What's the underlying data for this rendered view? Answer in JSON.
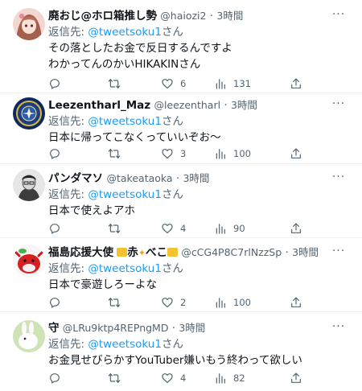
{
  "colors": {
    "text_primary": "#0f1419",
    "text_secondary": "#536471",
    "link": "#1d9bf0",
    "divider": "#eff3f4"
  },
  "tweets": [
    {
      "name": "廃おじ@ホロ箱推し勢",
      "handle": "@haiozi2",
      "dot": "·",
      "time": "3時間",
      "reply_prefix": "返信先: ",
      "reply_mention": "@tweetsoku1",
      "reply_suffix": "さん",
      "lines": [
        "その落としたお金で反日するんですよ",
        "わかってんのかいHIKAKINさん"
      ],
      "replies": "",
      "retweets": "",
      "likes": "6",
      "views": "131",
      "avatar_icon": "anime-character-avatar"
    },
    {
      "name": "Leezentharl_Maz",
      "handle": "@leezentharl",
      "dot": "·",
      "time": "3時間",
      "reply_prefix": "返信先: ",
      "reply_mention": "@tweetsoku1",
      "reply_suffix": "さん",
      "lines": [
        "日本に帰ってこなくっていいぞお～"
      ],
      "replies": "",
      "retweets": "",
      "likes": "3",
      "views": "100",
      "avatar_icon": "seal-emblem-avatar"
    },
    {
      "name": "パンダマソ",
      "handle": "@takeataoka",
      "dot": "·",
      "time": "3時間",
      "reply_prefix": "返信先: ",
      "reply_mention": "@tweetsoku1",
      "reply_suffix": "さん",
      "lines": [
        "日本で使えよアホ"
      ],
      "replies": "",
      "retweets": "",
      "likes": "4",
      "views": "90",
      "avatar_icon": "sketch-portrait-avatar"
    },
    {
      "name": "福島応援大使",
      "name_suffix_1": "赤",
      "name_suffix_2": "べこ",
      "handle": "@cCG4P8C7rlNzzSp",
      "dot": "·",
      "time": "3時間",
      "reply_prefix": "返信先: ",
      "reply_mention": "@tweetsoku1",
      "reply_suffix": "さん",
      "lines": [
        "日本で豪遊しろーよな"
      ],
      "replies": "",
      "retweets": "",
      "likes": "2",
      "views": "100",
      "avatar_icon": "red-cow-avatar"
    },
    {
      "name": "守",
      "handle": "@LRu9ktp4REPngMD",
      "dot": "·",
      "time": "3時間",
      "reply_prefix": "返信先: ",
      "reply_mention": "@tweetsoku1",
      "reply_suffix": "さん",
      "lines": [
        "お金見せびらかすYouTuber嫌いもう終わって欲しい"
      ],
      "replies": "",
      "retweets": "",
      "likes": "4",
      "views": "82",
      "avatar_icon": "white-rabbit-avatar"
    }
  ]
}
